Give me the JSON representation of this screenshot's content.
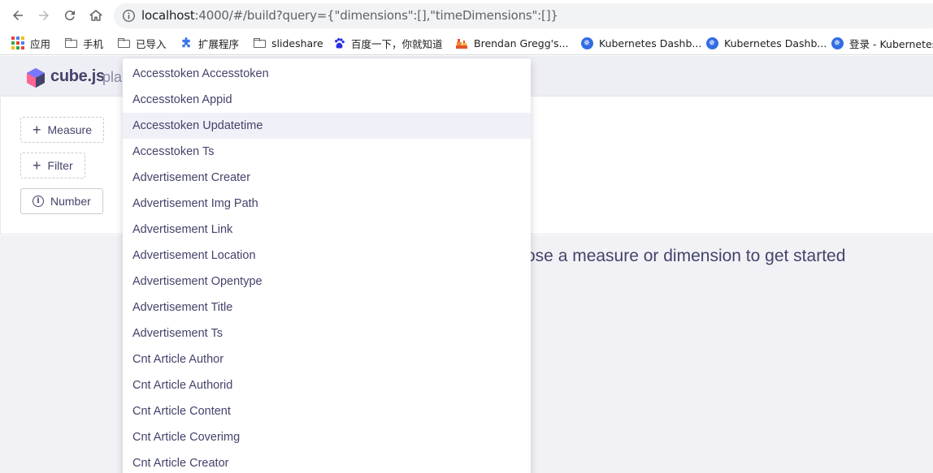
{
  "browser": {
    "url_host": "localhost",
    "url_rest": ":4000/#/build?query={\"dimensions\":[],\"timeDimensions\":[]}",
    "icons": [
      "back-arrow-icon",
      "forward-arrow-icon",
      "reload-icon",
      "home-icon",
      "info-icon"
    ]
  },
  "bookmarks": [
    {
      "label": "应用",
      "icon": "apps-grid-icon"
    },
    {
      "label": "手机",
      "icon": "folder-icon"
    },
    {
      "label": "已导入",
      "icon": "folder-icon"
    },
    {
      "label": "扩展程序",
      "icon": "puzzle-icon"
    },
    {
      "label": "slideshare",
      "icon": "folder-icon"
    },
    {
      "label": "百度一下，你就知道",
      "icon": "baidu-paw-icon"
    },
    {
      "label": "Brendan Gregg's...",
      "icon": "flame-icon"
    },
    {
      "label": "Kubernetes Dashb...",
      "icon": "kubernetes-icon"
    },
    {
      "label": "Kubernetes Dashb...",
      "icon": "kubernetes-icon"
    },
    {
      "label": "登录 - Kubernetes",
      "icon": "kubernetes-icon"
    }
  ],
  "app": {
    "logo_text": "cube.js",
    "logo_sub": "pla",
    "brand_colors": {
      "primary": "#43436b",
      "accent": "#7a77ff",
      "pink": "#ff6492"
    }
  },
  "builder": {
    "measure_label": "Measure",
    "filter_label": "Filter",
    "number_label": "Number"
  },
  "main": {
    "hint_text": "ose a measure or dimension to get started"
  },
  "dropdown": {
    "highlighted_index": 2,
    "items": [
      "Accesstoken Accesstoken",
      "Accesstoken Appid",
      "Accesstoken Updatetime",
      "Accesstoken Ts",
      "Advertisement Creater",
      "Advertisement Img Path",
      "Advertisement Link",
      "Advertisement Location",
      "Advertisement Opentype",
      "Advertisement Title",
      "Advertisement Ts",
      "Cnt Article Author",
      "Cnt Article Authorid",
      "Cnt Article Content",
      "Cnt Article Coverimg",
      "Cnt Article Creator"
    ]
  }
}
